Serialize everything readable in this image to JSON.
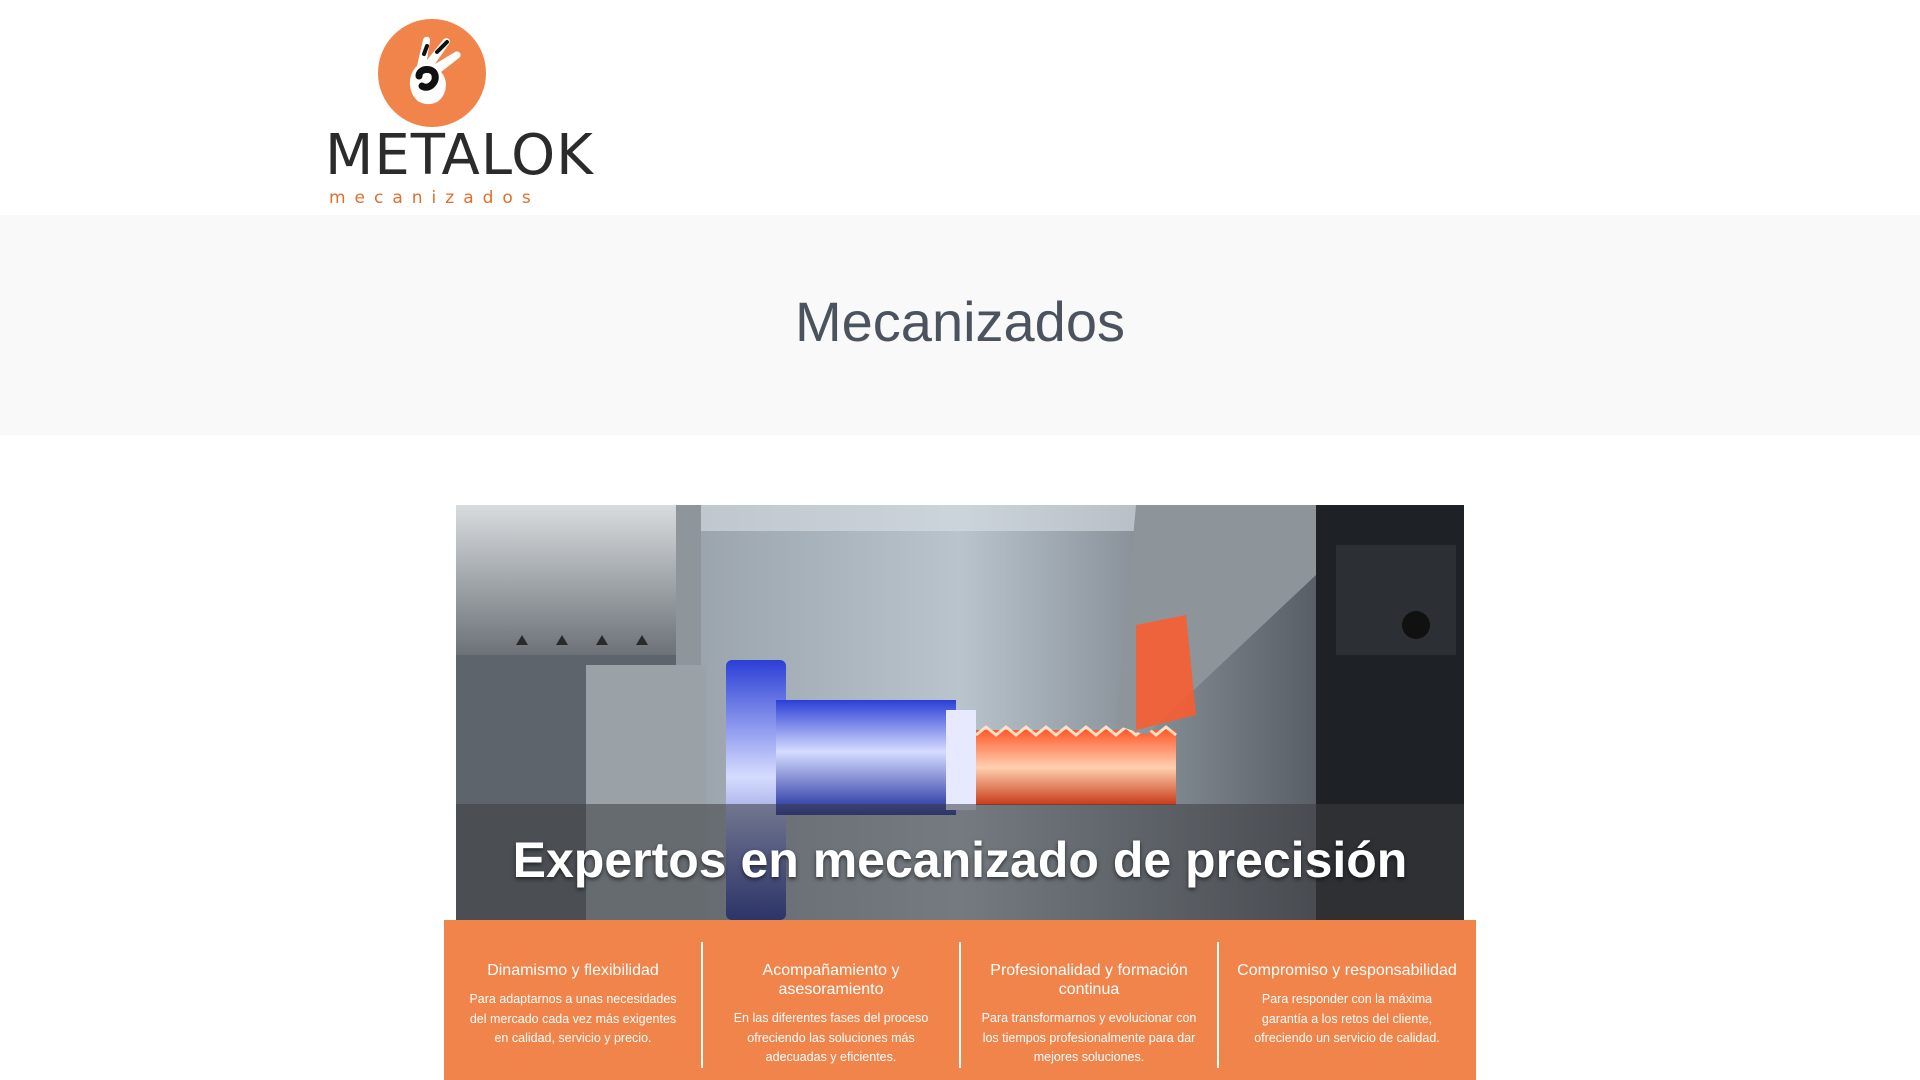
{
  "logo": {
    "brand": "METALOK",
    "tagline": "mecanizados",
    "accent_color": "#f0844a"
  },
  "page": {
    "title": "Mecanizados"
  },
  "hero": {
    "caption": "Expertos en mecanizado de precisión"
  },
  "features": [
    {
      "title": "Dinamismo y flexibilidad",
      "text": "Para adaptarnos a unas necesidades del mercado cada vez más exigentes en calidad, servicio y precio."
    },
    {
      "title": "Acompañamiento y asesoramiento",
      "text": "En las diferentes fases del proceso ofreciendo las soluciones más adecuadas y eficientes."
    },
    {
      "title": "Profesionalidad y formación continua",
      "text": "Para transformarnos y evolucionar con los tiempos profesionalmente para dar mejores soluciones."
    },
    {
      "title": "Compromiso y responsabilidad",
      "text": "Para responder con la máxima garantía a los retos del cliente, ofreciendo un servicio de calidad."
    }
  ],
  "colors": {
    "feature_band": "#f0844a",
    "title_text": "#4b545e",
    "title_band": "#f9f9fa"
  }
}
